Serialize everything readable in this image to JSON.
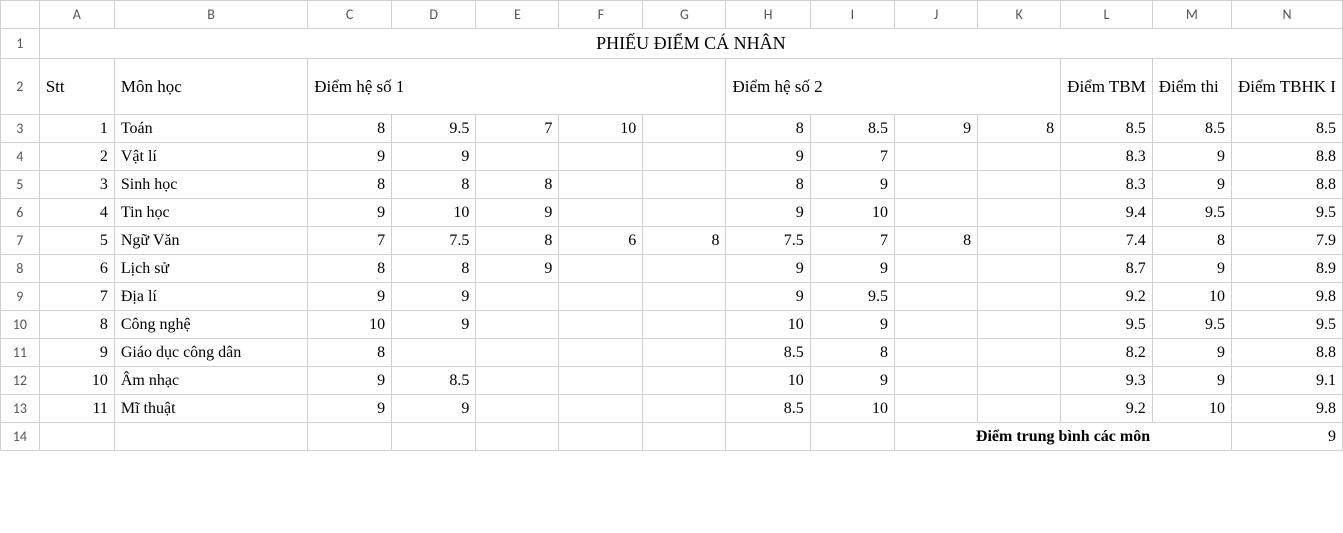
{
  "columns": [
    "A",
    "B",
    "C",
    "D",
    "E",
    "F",
    "G",
    "H",
    "I",
    "J",
    "K",
    "L",
    "M",
    "N"
  ],
  "title": "PHIẾU ĐIỂM CÁ NHÂN",
  "headers": {
    "stt": "Stt",
    "monhoc": "Môn học",
    "diemhe1": "Điểm hệ số 1",
    "diemhe2": "Điểm hệ số 2",
    "diemtbm": "Điểm TBM",
    "diemthi": "Điểm thi",
    "diemtbhk": "Điểm TBHK I"
  },
  "rows": [
    {
      "stt": "1",
      "mon": "Toán",
      "c": "8",
      "d": "9.5",
      "e": "7",
      "f": "10",
      "g": "",
      "h": "8",
      "i": "8.5",
      "j": "9",
      "k": "8",
      "l": "8.5",
      "m": "8.5",
      "n": "8.5"
    },
    {
      "stt": "2",
      "mon": "Vật lí",
      "c": "9",
      "d": "9",
      "e": "",
      "f": "",
      "g": "",
      "h": "9",
      "i": "7",
      "j": "",
      "k": "",
      "l": "8.3",
      "m": "9",
      "n": "8.8"
    },
    {
      "stt": "3",
      "mon": "Sinh học",
      "c": "8",
      "d": "8",
      "e": "8",
      "f": "",
      "g": "",
      "h": "8",
      "i": "9",
      "j": "",
      "k": "",
      "l": "8.3",
      "m": "9",
      "n": "8.8"
    },
    {
      "stt": "4",
      "mon": "Tin học",
      "c": "9",
      "d": "10",
      "e": "9",
      "f": "",
      "g": "",
      "h": "9",
      "i": "10",
      "j": "",
      "k": "",
      "l": "9.4",
      "m": "9.5",
      "n": "9.5"
    },
    {
      "stt": "5",
      "mon": "Ngữ Văn",
      "c": "7",
      "d": "7.5",
      "e": "8",
      "f": "6",
      "g": "8",
      "h": "7.5",
      "i": "7",
      "j": "8",
      "k": "",
      "l": "7.4",
      "m": "8",
      "n": "7.9"
    },
    {
      "stt": "6",
      "mon": "Lịch sử",
      "c": "8",
      "d": "8",
      "e": "9",
      "f": "",
      "g": "",
      "h": "9",
      "i": "9",
      "j": "",
      "k": "",
      "l": "8.7",
      "m": "9",
      "n": "8.9"
    },
    {
      "stt": "7",
      "mon": "Địa lí",
      "c": "9",
      "d": "9",
      "e": "",
      "f": "",
      "g": "",
      "h": "9",
      "i": "9.5",
      "j": "",
      "k": "",
      "l": "9.2",
      "m": "10",
      "n": "9.8"
    },
    {
      "stt": "8",
      "mon": "Công nghệ",
      "c": "10",
      "d": "9",
      "e": "",
      "f": "",
      "g": "",
      "h": "10",
      "i": "9",
      "j": "",
      "k": "",
      "l": "9.5",
      "m": "9.5",
      "n": "9.5"
    },
    {
      "stt": "9",
      "mon": "Giáo dục công dân",
      "c": "8",
      "d": "",
      "e": "",
      "f": "",
      "g": "",
      "h": "8.5",
      "i": "8",
      "j": "",
      "k": "",
      "l": "8.2",
      "m": "9",
      "n": "8.8"
    },
    {
      "stt": "10",
      "mon": "Âm nhạc",
      "c": "9",
      "d": "8.5",
      "e": "",
      "f": "",
      "g": "",
      "h": "10",
      "i": "9",
      "j": "",
      "k": "",
      "l": "9.3",
      "m": "9",
      "n": "9.1"
    },
    {
      "stt": "11",
      "mon": "Mĩ thuật",
      "c": "9",
      "d": "9",
      "e": "",
      "f": "",
      "g": "",
      "h": "8.5",
      "i": "10",
      "j": "",
      "k": "",
      "l": "9.2",
      "m": "10",
      "n": "9.8"
    }
  ],
  "footer": {
    "label": "Điểm trung bình các môn",
    "value": "9"
  },
  "rowNumbers": [
    "1",
    "2",
    "3",
    "4",
    "5",
    "6",
    "7",
    "8",
    "9",
    "10",
    "11",
    "12",
    "13",
    "14"
  ]
}
